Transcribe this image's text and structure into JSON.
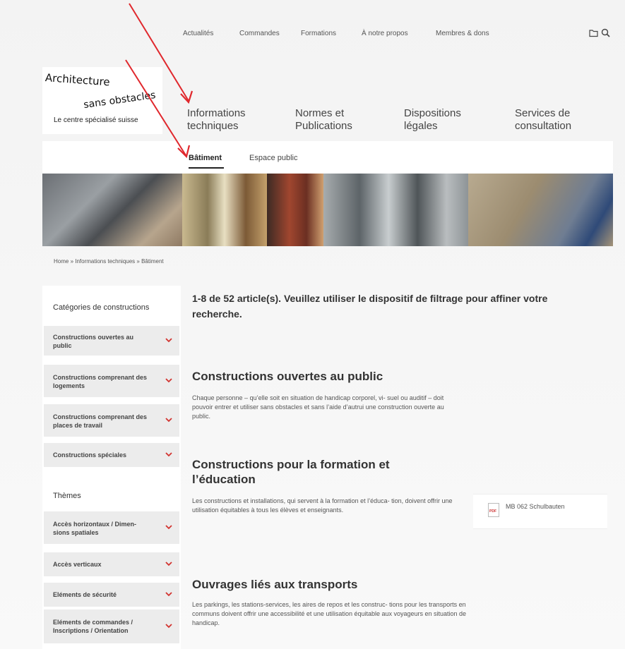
{
  "top_nav": [
    "Actualités",
    "Commandes",
    "Formations",
    "À notre propos",
    "Membres & dons"
  ],
  "logo": {
    "line1": "Architecture",
    "line2": "sans obstacles",
    "tagline": "Le centre spécialisé suisse"
  },
  "main_nav": [
    {
      "line1": "Informations",
      "line2": "techniques"
    },
    {
      "line1": "Normes et",
      "line2": "Publications"
    },
    {
      "line1": "Dispositions",
      "line2": "légales"
    },
    {
      "line1": "Services de",
      "line2": "consultation"
    }
  ],
  "sub_nav": [
    "Bâtiment",
    "Espace public"
  ],
  "breadcrumb": "Home » Informations techniques » Bâtiment",
  "sidebar": {
    "categories_heading": "Catégories de constructions",
    "categories": [
      "Constructions ouvertes au public",
      "Constructions comprenant des logements",
      "Constructions comprenant des places de travail",
      "Constructions spéciales"
    ],
    "themes_heading": "Thèmes",
    "themes": [
      "Accès horizontaux / Dimen- sions spatiales",
      "Accès verticaux",
      "Eléments de sécurité",
      "Eléments de commandes / Inscriptions / Orientation"
    ]
  },
  "results_heading": "1-8 de 52 article(s). Veuillez utiliser le dispositif de filtrage pour affiner votre recherche.",
  "articles": [
    {
      "title": "Constructions ouvertes au public",
      "text": "Chaque personne – qu’elle soit en situation de handicap corporel, vi- suel ou auditif – doit pouvoir entrer et utiliser sans obstacles et sans l’aide d’autrui une construction ouverte au public."
    },
    {
      "title": "Constructions pour la formation et l’éducation",
      "text": "Les constructions et installations, qui servent à la formation et l’éduca- tion, doivent offrir une utilisation équitables à tous les élèves et enseignants."
    },
    {
      "title": "Ouvrages liés aux transports",
      "text": "Les parkings, les stations-services, les aires de repos et les construc- tions pour les transports en communs doivent offrir une accessibilité et une utilisation équitable aux voyageurs en situation de handicap."
    }
  ],
  "pdf_link": "MB 062 Schulbauten",
  "pdf_icon_text": "PDF",
  "colors": {
    "chevron": "#d2332f",
    "annotation_arrow": "#e0282d",
    "sidebar_item_bg": "#ececec"
  }
}
